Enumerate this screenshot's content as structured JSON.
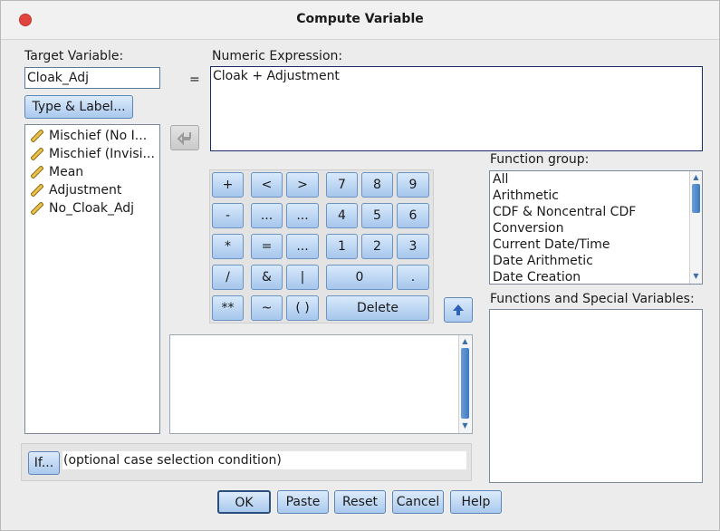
{
  "window": {
    "title": "Compute Variable"
  },
  "target": {
    "label": "Target Variable:",
    "value": "Cloak_Adj"
  },
  "equals": "=",
  "type_label_button": "Type & Label...",
  "numeric": {
    "label": "Numeric Expression:",
    "value": "Cloak + Adjustment"
  },
  "variables": [
    "Mischief (No I...",
    "Mischief (Invisi...",
    "Mean",
    "Adjustment",
    "No_Cloak_Adj"
  ],
  "keypad": {
    "row1": [
      "+",
      "<",
      ">",
      "7",
      "8",
      "9"
    ],
    "row2": [
      "-",
      "...",
      "...",
      "4",
      "5",
      "6"
    ],
    "row3": [
      "*",
      "=",
      "...",
      "1",
      "2",
      "3"
    ],
    "row4": [
      "/",
      "&",
      "|",
      "0",
      "."
    ],
    "row5": [
      "**",
      "~",
      "( )",
      "Delete"
    ]
  },
  "function_group": {
    "label": "Function group:",
    "items": [
      "All",
      "Arithmetic",
      "CDF & Noncentral CDF",
      "Conversion",
      "Current Date/Time",
      "Date Arithmetic",
      "Date Creation"
    ]
  },
  "functions_label": "Functions and Special Variables:",
  "if_button": "If...",
  "if_text": "(optional case selection condition)",
  "buttons": {
    "ok": "OK",
    "paste": "Paste",
    "reset": "Reset",
    "cancel": "Cancel",
    "help": "Help"
  },
  "colors": {
    "close": "#e0443e",
    "button_top": "#dcebfb",
    "button_bottom": "#a9c9ee",
    "scroll_thumb": "#3d7ac3"
  }
}
